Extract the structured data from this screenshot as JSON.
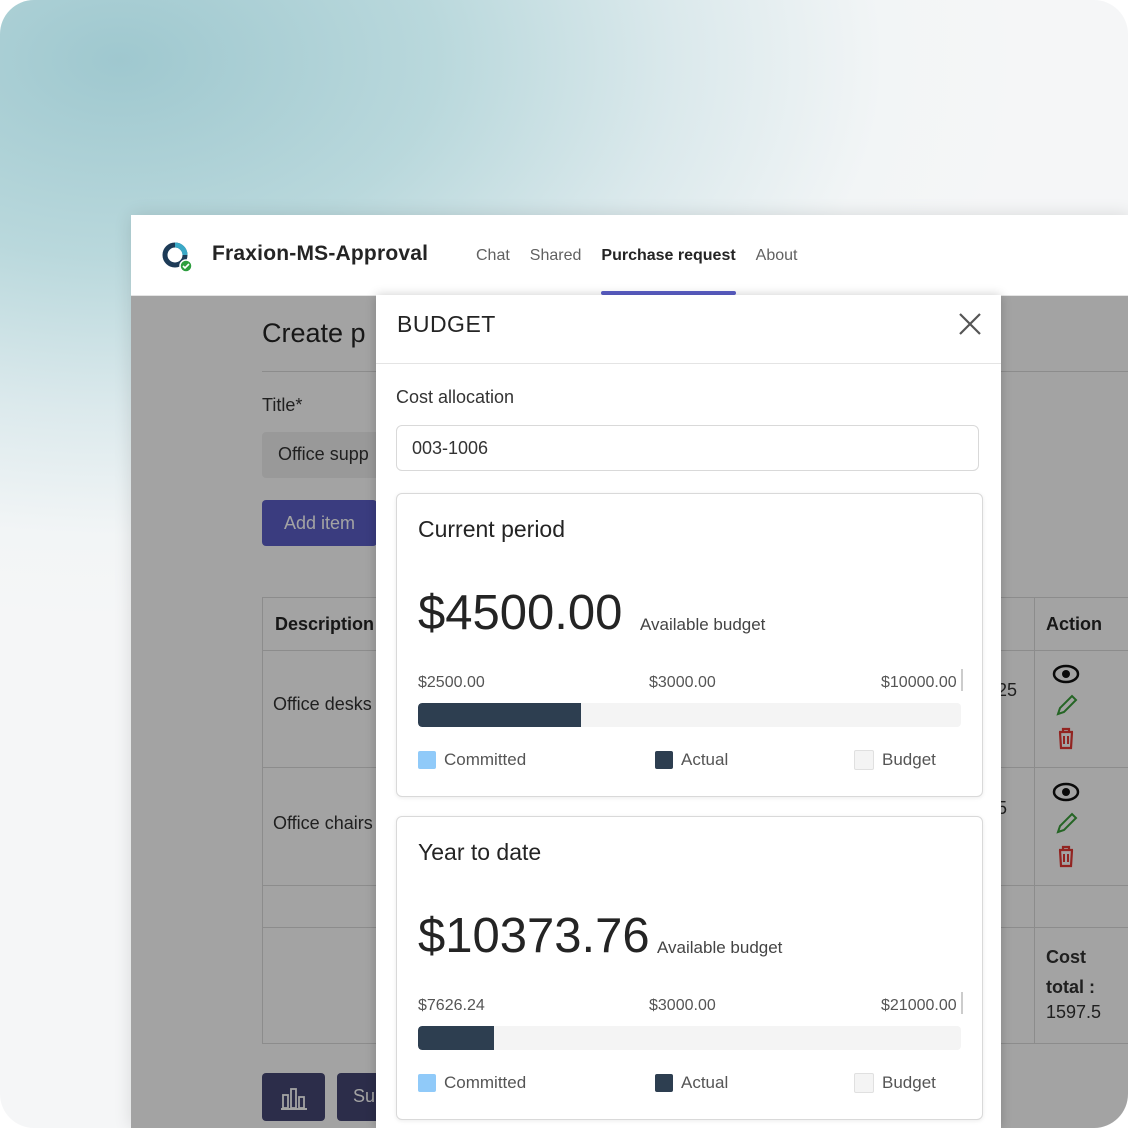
{
  "app": {
    "title": "Fraxion-MS-Approval",
    "nav": [
      "Chat",
      "Shared",
      "Purchase request",
      "About"
    ],
    "active_nav": "Purchase request",
    "accent_color": "#5b5fc7"
  },
  "background_page": {
    "heading": "Create p",
    "title_label": "Title*",
    "title_value": "Office supp",
    "add_item_label": "Add item",
    "table": {
      "col_description": "Description",
      "col_action": "Action",
      "rows": [
        {
          "description": "Office desks",
          "partial_value": "25"
        },
        {
          "description": "Office chairs",
          "partial_value": "5"
        }
      ],
      "cost_total_label": "Cost total :",
      "cost_total_value": "1597.5"
    },
    "submit_label": "Su",
    "icons": [
      "eye-icon",
      "pencil-icon",
      "trash-icon",
      "bar-chart-icon"
    ]
  },
  "modal": {
    "title": "BUDGET",
    "cost_allocation_label": "Cost allocation",
    "cost_allocation_value": "003-1006",
    "cards": [
      {
        "title": "Current period",
        "amount": "$4500.00",
        "amount_label": "Available budget",
        "scale": {
          "left": "$2500.00",
          "mid": "$3000.00",
          "right": "$10000.00"
        },
        "actual_fraction": 0.3,
        "legend": {
          "committed": "Committed",
          "actual": "Actual",
          "budget": "Budget"
        }
      },
      {
        "title": "Year to date",
        "amount": "$10373.76",
        "amount_label": "Available budget",
        "scale": {
          "left": "$7626.24",
          "mid": "$3000.00",
          "right": "$21000.00"
        },
        "actual_fraction": 0.14,
        "legend": {
          "committed": "Committed",
          "actual": "Actual",
          "budget": "Budget"
        }
      }
    ],
    "colors": {
      "committed": "#90caf9",
      "actual": "#2d3e50",
      "budget": "#f4f4f4"
    }
  }
}
